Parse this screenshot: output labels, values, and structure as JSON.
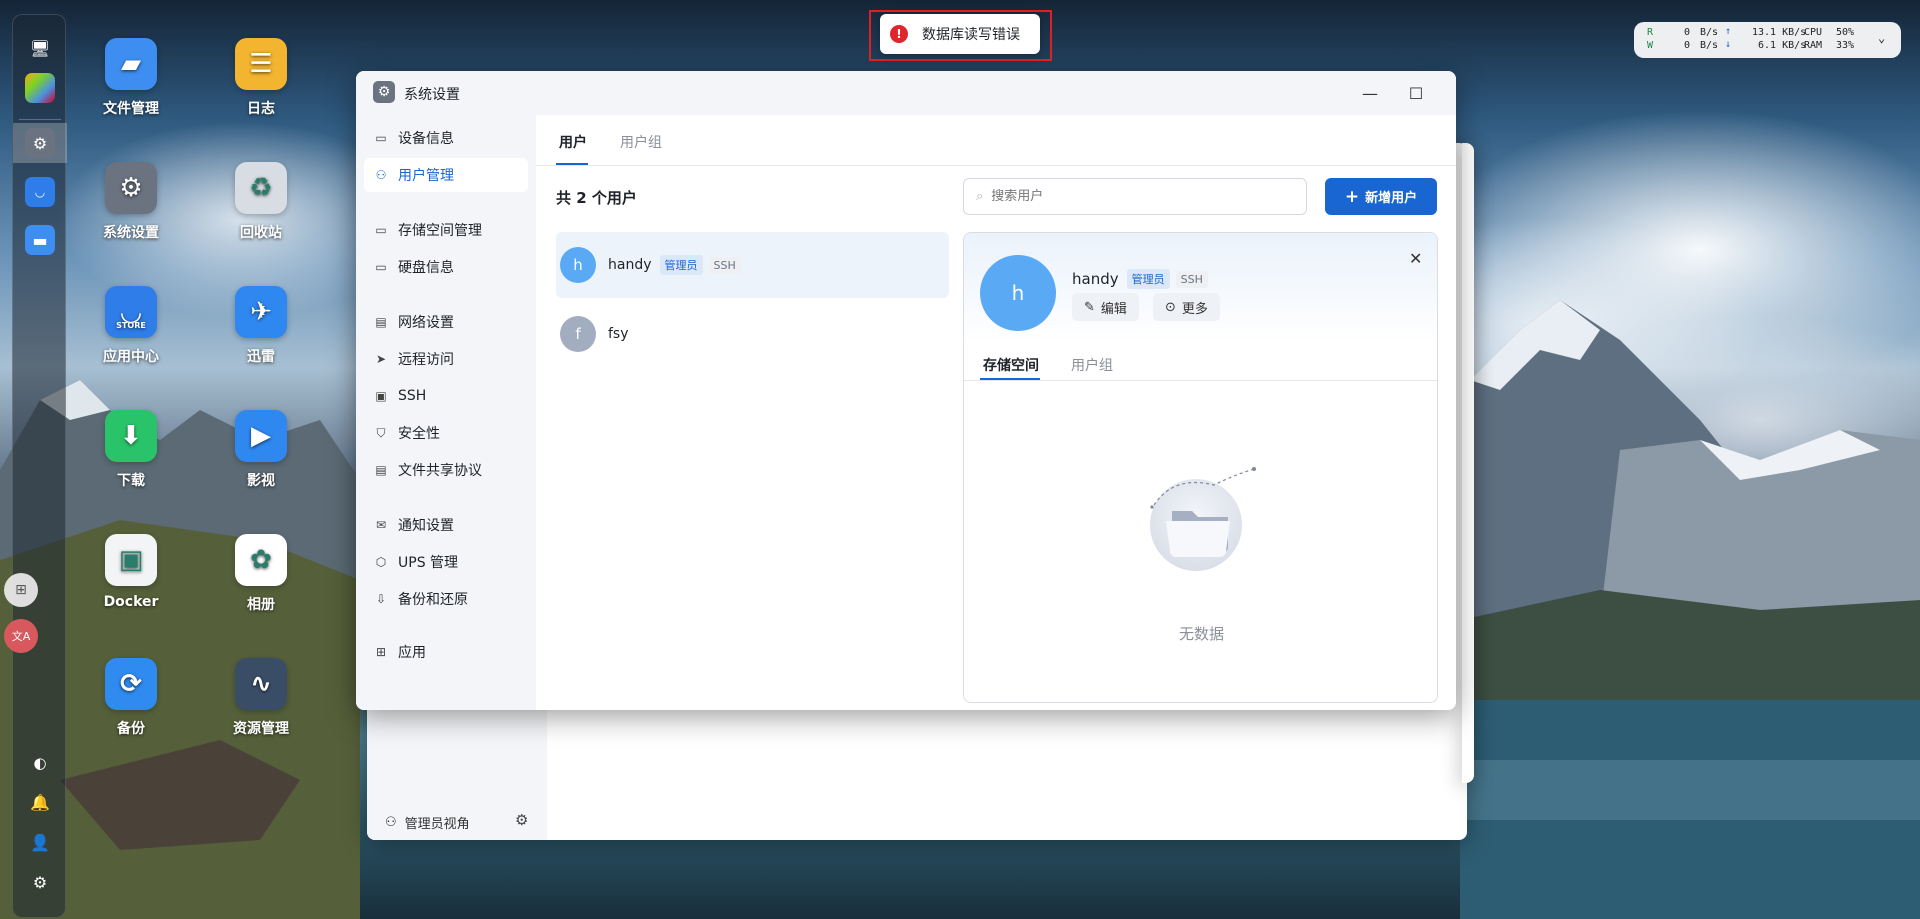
{
  "toast": {
    "message": "数据库读写错误"
  },
  "monitor": {
    "read_label": "R",
    "write_label": "W",
    "disk_read": "0",
    "disk_write": "0",
    "disk_unit_r": "B/s",
    "disk_unit_w": "B/s",
    "net_up": "13.1 KB/s",
    "net_down": "6.1 KB/s",
    "cpu_label": "CPU",
    "cpu_value": "50%",
    "ram_label": "RAM",
    "ram_value": "33%"
  },
  "desktop": {
    "icons": [
      {
        "label": "文件管理",
        "icon": "folder-icon",
        "color": "#3d8ef0"
      },
      {
        "label": "日志",
        "icon": "log-icon",
        "color": "#f3b52f"
      },
      {
        "label": "系统设置",
        "icon": "gear-icon",
        "color": "#6b7380"
      },
      {
        "label": "回收站",
        "icon": "recycle-icon",
        "color": "#d7dde3"
      },
      {
        "label": "应用中心",
        "icon": "store-icon",
        "color": "#2f7de8"
      },
      {
        "label": "迅雷",
        "icon": "bird-icon",
        "color": "#2f87f0"
      },
      {
        "label": "下载",
        "icon": "download-icon",
        "color": "#29c46a"
      },
      {
        "label": "影视",
        "icon": "video-icon",
        "color": "#2f87f0"
      },
      {
        "label": "Docker",
        "icon": "docker-icon",
        "color": "#f2f4f6"
      },
      {
        "label": "相册",
        "icon": "photos-icon",
        "color": "#ffffff"
      },
      {
        "label": "备份",
        "icon": "backup-icon",
        "color": "#2f8bf0"
      },
      {
        "label": "资源管理",
        "icon": "monitor-icon",
        "color": "#3a4d66"
      }
    ],
    "store_badge": "STORE"
  },
  "window": {
    "title": "系统设置",
    "sidebar": [
      {
        "label": "设备信息",
        "icon": "device-icon"
      },
      {
        "label": "用户管理",
        "icon": "users-icon"
      },
      {
        "label": "存储空间管理",
        "icon": "storage-icon"
      },
      {
        "label": "硬盘信息",
        "icon": "disk-icon"
      },
      {
        "label": "网络设置",
        "icon": "network-icon"
      },
      {
        "label": "远程访问",
        "icon": "send-icon"
      },
      {
        "label": "SSH",
        "icon": "terminal-icon"
      },
      {
        "label": "安全性",
        "icon": "shield-icon"
      },
      {
        "label": "文件共享协议",
        "icon": "file-icon"
      },
      {
        "label": "通知设置",
        "icon": "mail-icon"
      },
      {
        "label": "UPS 管理",
        "icon": "ups-icon"
      },
      {
        "label": "备份和还原",
        "icon": "backup-restore-icon"
      },
      {
        "label": "应用",
        "icon": "apps-icon"
      }
    ],
    "tabs": [
      "用户",
      "用户组"
    ],
    "user_count": "共 2 个用户",
    "search_placeholder": "搜索用户",
    "add_user_label": "新增用户",
    "users": [
      {
        "avatar": "h",
        "name": "handy",
        "tags": [
          "管理员",
          "SSH"
        ],
        "color": "#5aa9f5"
      },
      {
        "avatar": "f",
        "name": "fsy",
        "tags": [],
        "color": "#a3adc0"
      }
    ],
    "detail": {
      "avatar": "h",
      "name": "handy",
      "tags": [
        "管理员",
        "SSH"
      ],
      "edit_label": "编辑",
      "more_label": "更多",
      "tabs": [
        "存储空间",
        "用户组"
      ],
      "empty_text": "无数据"
    }
  },
  "back_window": {
    "footer_label": "管理员视角"
  }
}
